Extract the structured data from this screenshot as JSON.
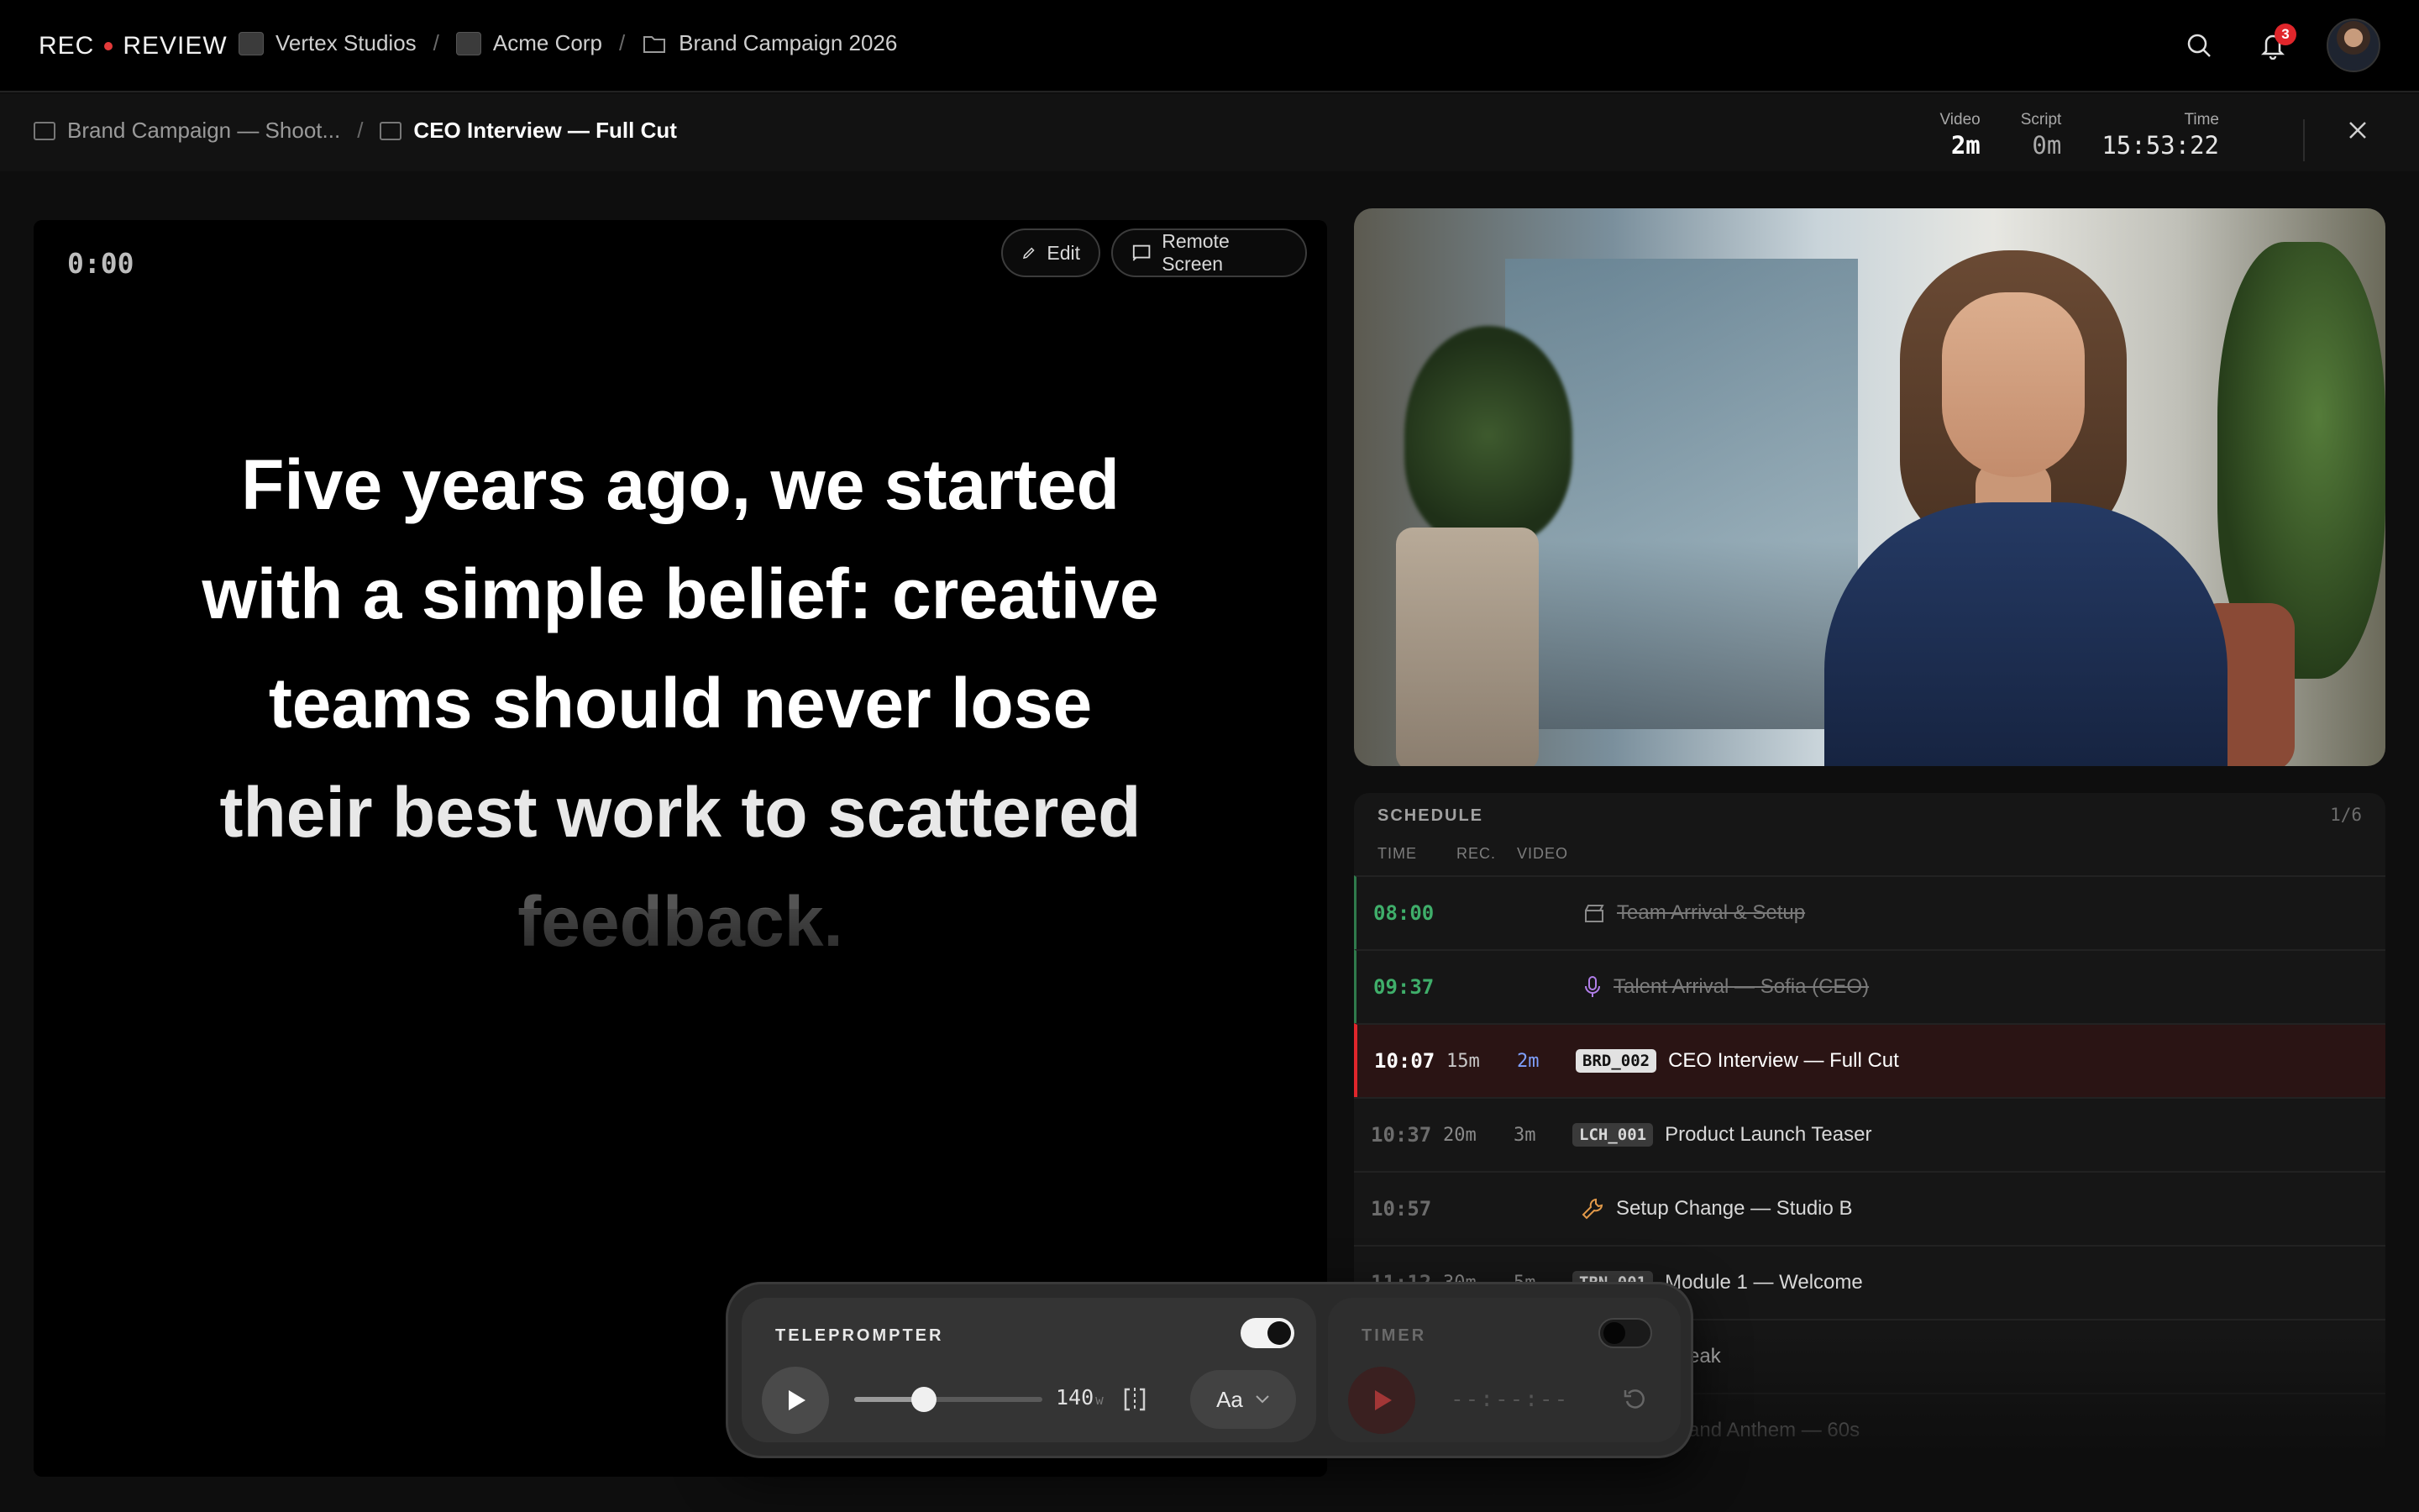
{
  "app": {
    "logo_left": "REC",
    "logo_right": "REVIEW"
  },
  "breadcrumb": [
    {
      "label": "Vertex Studios"
    },
    {
      "label": "Acme Corp"
    },
    {
      "label": "Brand Campaign 2026"
    }
  ],
  "notifications": {
    "count": "3"
  },
  "subbar": {
    "parent": "Brand Campaign — Shoot...",
    "current": "CEO Interview — Full Cut"
  },
  "stats": [
    {
      "label": "Video",
      "value": "2m"
    },
    {
      "label": "Script",
      "value": "0m"
    },
    {
      "label": "Time",
      "value": "15:53:22"
    }
  ],
  "prompter": {
    "timecode": "0:00",
    "edit_label": "Edit",
    "remote_label": "Remote Screen",
    "lines": [
      "Five years ago, we started",
      "with a simple belief: creative",
      "teams should never lose",
      "their best work to scattered",
      "feedback."
    ]
  },
  "schedule": {
    "title": "SCHEDULE",
    "page": "1/6",
    "columns": [
      "TIME",
      "REC.",
      "VIDEO"
    ],
    "rows": [
      {
        "time": "08:00",
        "rec": "",
        "video": "",
        "code": "",
        "icon": "clapperboard-icon",
        "name": "Team Arrival & Setup",
        "state": "done"
      },
      {
        "time": "09:37",
        "rec": "",
        "video": "",
        "code": "",
        "icon": "microphone-icon",
        "name": "Talent Arrival — Sofia (CEO)",
        "state": "done"
      },
      {
        "time": "10:07",
        "rec": "15m",
        "video": "2m",
        "code": "BRD_002",
        "icon": "",
        "name": "CEO Interview — Full Cut",
        "state": "active"
      },
      {
        "time": "10:37",
        "rec": "20m",
        "video": "3m",
        "code": "LCH_001",
        "icon": "",
        "name": "Product Launch Teaser",
        "state": "upcoming"
      },
      {
        "time": "10:57",
        "rec": "",
        "video": "",
        "code": "",
        "icon": "wrench-icon",
        "name": "Setup Change — Studio B",
        "state": "upcoming"
      },
      {
        "time": "11:12",
        "rec": "30m",
        "video": "5m",
        "code": "TRN_001",
        "icon": "",
        "name": "Module 1 — Welcome",
        "state": "upcoming"
      },
      {
        "time": "",
        "rec": "",
        "video": "",
        "code": "",
        "icon": "",
        "name": "Break",
        "state": "upcoming"
      },
      {
        "time": "",
        "rec": "",
        "video": "",
        "code": "",
        "icon": "",
        "name": "Brand Anthem — 60s",
        "state": "upcoming"
      }
    ]
  },
  "controls": {
    "teleprompter_title": "TELEPROMPTER",
    "teleprompter_enabled": true,
    "speed_value": "140",
    "speed_unit": "w",
    "speed_fraction": 0.37,
    "font_label": "Aa",
    "timer_title": "TIMER",
    "timer_enabled": false,
    "timer_readout": "--:--:--"
  },
  "colors": {
    "accent_red": "#e0262b",
    "done_green": "#3fae6a",
    "video_blue": "#7fa0ff"
  }
}
